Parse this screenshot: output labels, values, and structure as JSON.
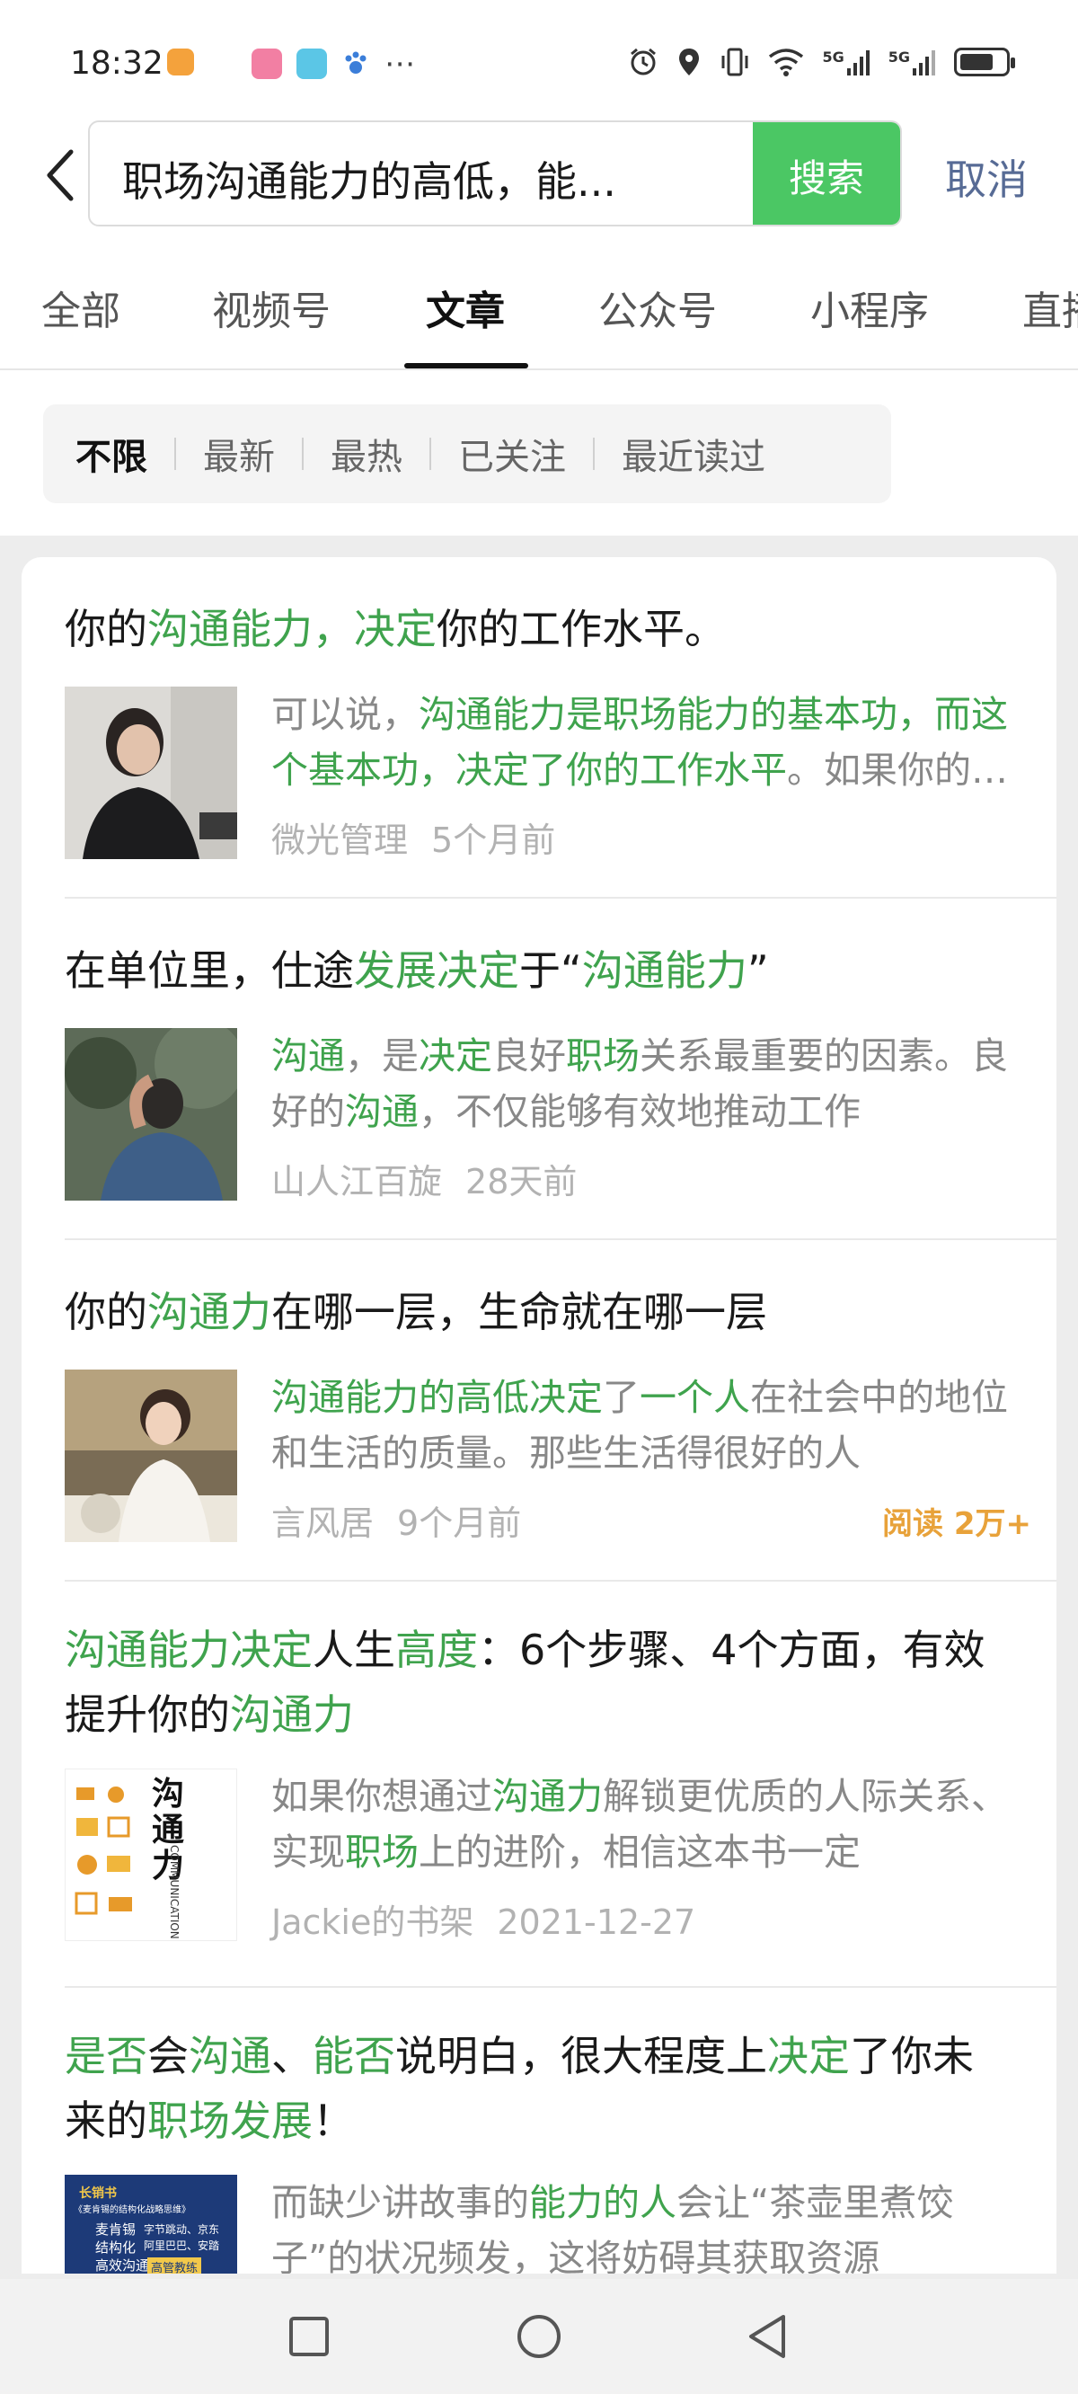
{
  "status_bar": {
    "time": "18:32",
    "network_label_1": "5G",
    "network_label_2": "5G"
  },
  "search": {
    "back_icon": "chevron-left-icon",
    "query": "职场沟通能力的高低，能...",
    "clear_icon": "clear-circle-icon",
    "search_button": "搜索",
    "cancel_button": "取消"
  },
  "tabs": [
    {
      "label": "全部"
    },
    {
      "label": "视频号"
    },
    {
      "label": "文章",
      "active": true
    },
    {
      "label": "公众号"
    },
    {
      "label": "小程序"
    },
    {
      "label": "直播"
    }
  ],
  "filters": [
    {
      "label": "不限",
      "active": true
    },
    {
      "label": "最新"
    },
    {
      "label": "最热"
    },
    {
      "label": "已关注"
    },
    {
      "label": "最近读过"
    }
  ],
  "results": [
    {
      "title_html": "你的<span class=\"hl\">沟通能力，决定</span>你的工作水平。",
      "snippet_html": "可以说，<span class=\"hl\">沟通能力是职场能力的基本功，而这个基本功，决定了你的工作水平</span>。如果你的沟通能力不足",
      "source": "微光管理",
      "time": "5个月前",
      "reads": ""
    },
    {
      "title_html": "在单位里，仕途<span class=\"hl\">发展决定</span>于“<span class=\"hl\">沟通能力</span>”",
      "snippet_html": "<span class=\"hl\">沟通</span>，是<span class=\"hl\">决定</span>良好<span class=\"hl\">职场</span>关系最重要的因素。良好的<span class=\"hl\">沟通</span>，不仅能够有效地推动工作",
      "source": "山人江百旋",
      "time": "28天前",
      "reads": ""
    },
    {
      "title_html": "你的<span class=\"hl\">沟通力</span>在哪一层，生命就在哪一层",
      "snippet_html": "<span class=\"hl\">沟通能力的高低决定</span>了<span class=\"hl\">一个人</span>在社会中的地位和生活的质量。那些生活得很好的人",
      "source": "言风居",
      "time": "9个月前",
      "reads": "阅读 2万+"
    },
    {
      "title_html": "<span class=\"hl\">沟通能力决定</span>人生<span class=\"hl\">高度</span>：6个步骤、4个方面，有效提升你的<span class=\"hl\">沟通力</span>",
      "snippet_html": "如果你想通过<span class=\"hl\">沟通力</span>解锁更优质的人际关系、实现<span class=\"hl\">职场</span>上的进阶，相信这本书一定",
      "source": "Jackie的书架",
      "time": "2021-12-27",
      "reads": ""
    },
    {
      "title_html": "<span class=\"hl\">是否</span>会<span class=\"hl\">沟通</span>、<span class=\"hl\">能否</span>说明白，很大程度上<span class=\"hl\">决定</span>了你未来的<span class=\"hl\">职场发展</span>！",
      "snippet_html": "而缺少讲故事的<span class=\"hl\">能力的人</span>会让“茶壶里煮饺子”的状况频发，这将妨碍其获取资源",
      "source": "",
      "time": "",
      "reads": ""
    }
  ],
  "book_cover_1": {
    "big_text": "沟通力",
    "side_text": "COMMUNICATION"
  },
  "book_cover_2": {
    "title": "长销书",
    "line1": "《麦肯锡的结构化战略思维》",
    "line2": "麦肯锡",
    "line3": "结构化",
    "line4": "高效沟通",
    "line5": "字节跳动、京东",
    "line6": "阿里巴巴、安踏",
    "line7": "高管教练"
  },
  "nav": {
    "recent_icon": "square-recent-apps-icon",
    "home_icon": "circle-home-icon",
    "back_icon": "triangle-back-icon"
  },
  "colors": {
    "accent_green": "#4bc764",
    "highlight_green": "#3fa34d",
    "link_blue": "#576b95",
    "reads_orange": "#e8a23a"
  }
}
